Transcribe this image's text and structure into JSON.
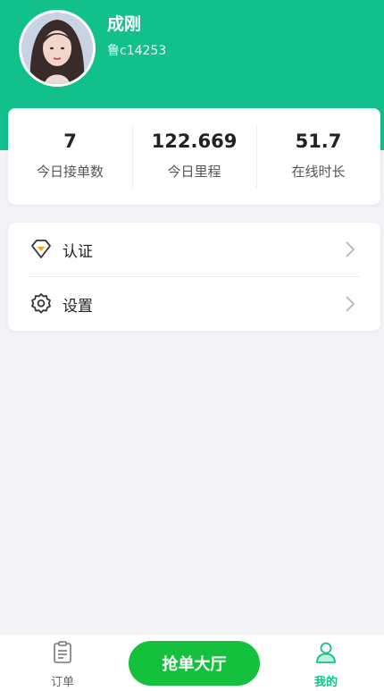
{
  "colors": {
    "brand_green": "#11c08a",
    "button_green": "#13c13d",
    "background": "#f4f3f8"
  },
  "profile": {
    "name": "成刚",
    "plate": "鲁c14253",
    "avatar": "user-avatar-photo"
  },
  "stats": [
    {
      "value": "7",
      "label": "今日接单数"
    },
    {
      "value": "122.669",
      "label": "今日里程"
    },
    {
      "value": "51.7",
      "label": "在线时长"
    }
  ],
  "menu": [
    {
      "label": "认证",
      "icon": "certification-icon"
    },
    {
      "label": "设置",
      "icon": "settings-gear-icon"
    }
  ],
  "bottom_nav": {
    "orders_label": "订单",
    "grab_label": "抢单大厅",
    "mine_label": "我的",
    "active_tab": "我的"
  }
}
